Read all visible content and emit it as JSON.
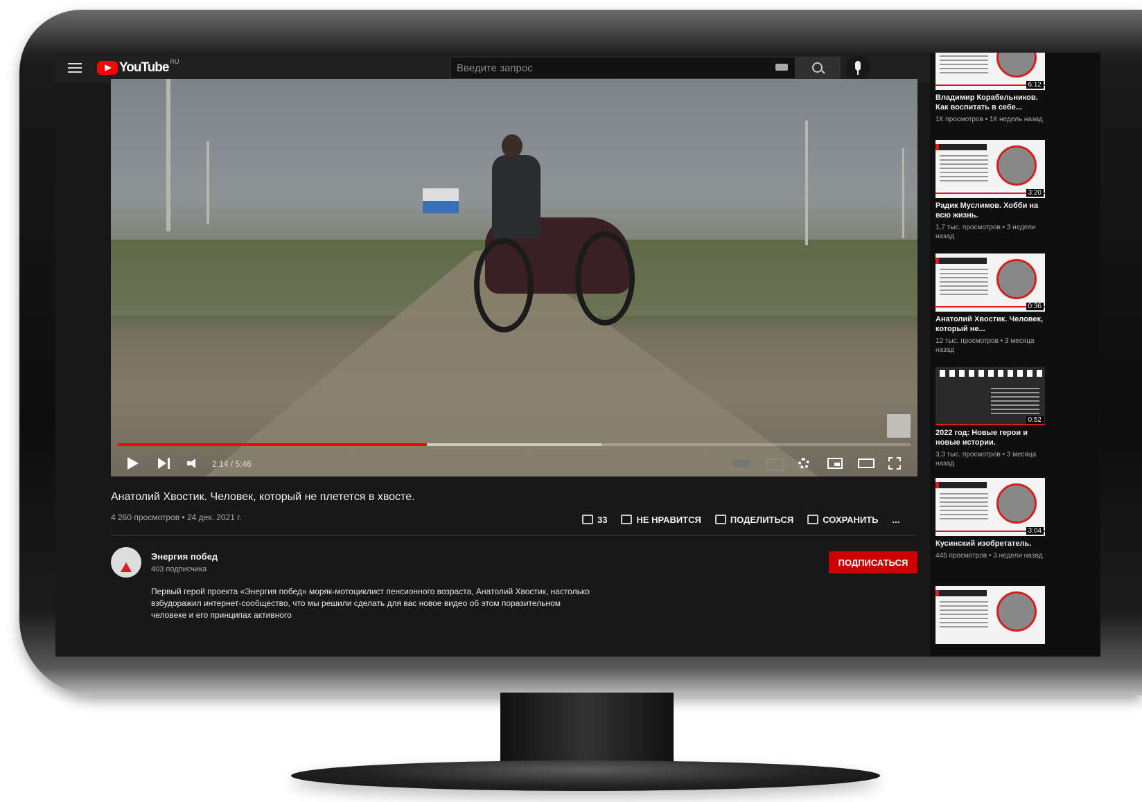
{
  "header": {
    "logo_text": "YouTube",
    "logo_region": "RU",
    "search_placeholder": "Введите запрос"
  },
  "player": {
    "time": "2:14 / 5:46",
    "progress_played_fraction": 0.39,
    "progress_buffered_fraction": 0.61
  },
  "video": {
    "title": "Анатолий Хвостик. Человек, который не плетется в хвосте.",
    "meta": "4 260 просмотров • 24 дек. 2021 г.",
    "actions": {
      "like_count": "33",
      "dislike": "НЕ НРАВИТСЯ",
      "share": "ПОДЕЛИТЬСЯ",
      "save": "СОХРАНИТЬ",
      "more": "..."
    }
  },
  "channel": {
    "name": "Энергия побед",
    "subscribers": "403 подписчика",
    "subscribe": "ПОДПИСАТЬСЯ",
    "description": "Первый герой проекта «Энергия побед» моряк-мотоциклист пенсионного возраста, Анатолий Хвостик, настолько взбудоражил интернет-сообщество, что мы решили сделать для вас новое видео об этом поразительном человеке и его принципах активного"
  },
  "recommendations": [
    {
      "title": "Владимир Корабельников. Как воспитать в себе...",
      "meta": "1К просмотров • 1К недель назад",
      "duration": "6:12"
    },
    {
      "title": "Радик Муслимов. Хобби на всю жизнь.",
      "meta": "1,7 тыс. просмотров • 3 недели назад",
      "duration": "3:20"
    },
    {
      "title": "Анатолий Хвостик. Человек, который не...",
      "meta": "12 тыс. просмотров • 3 месяца назад",
      "duration": "0:36"
    },
    {
      "title": "2022 год: Новые герои и новые истории.",
      "meta": "3,3 тыс. просмотров • 3 месяца назад",
      "duration": "0:52"
    },
    {
      "title": "Кусинский изобретатель.",
      "meta": "445 просмотров • 3 недели назад",
      "duration": "3:04"
    },
    {
      "title": "",
      "meta": "",
      "duration": ""
    }
  ],
  "colors": {
    "accent": "#ff0000",
    "subscribe_bg": "#cc0000",
    "page_bg": "#181818",
    "topbar_bg": "#202020"
  }
}
